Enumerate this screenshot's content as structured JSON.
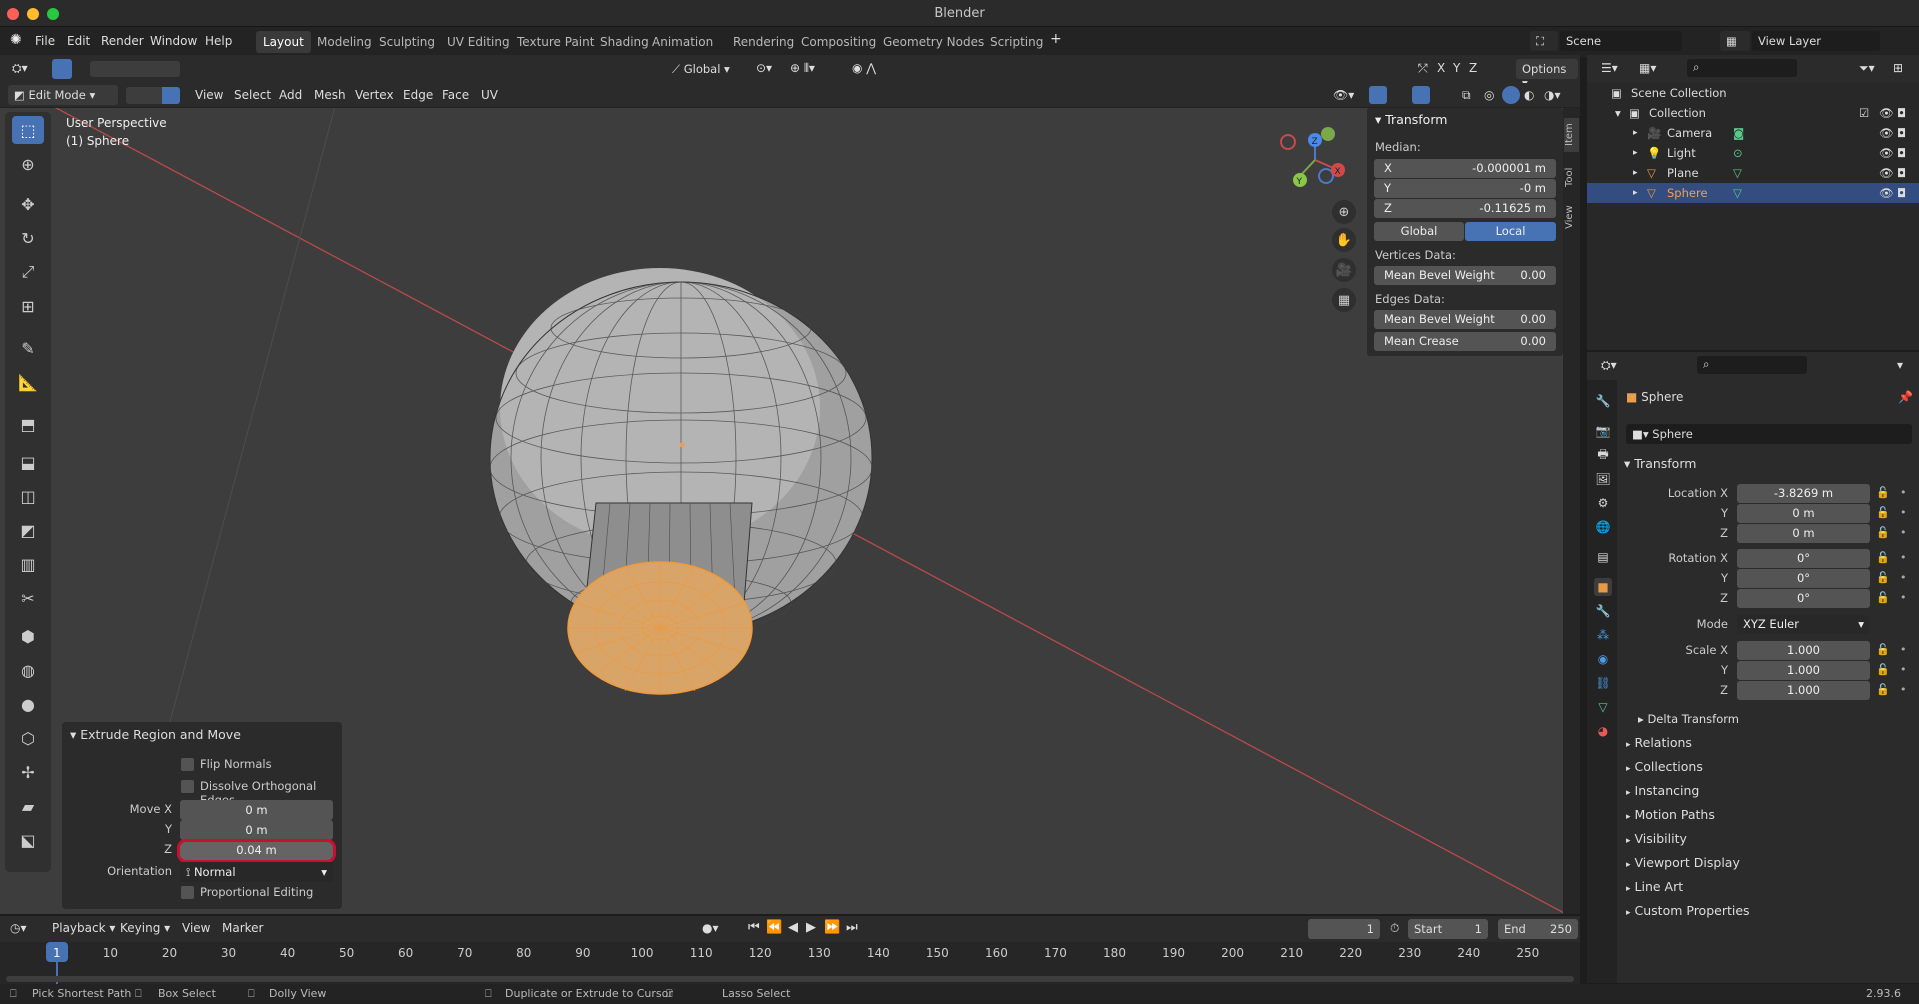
{
  "app": {
    "title": "Blender",
    "version": "2.93.6"
  },
  "menu": {
    "file": "File",
    "edit": "Edit",
    "render": "Render",
    "window": "Window",
    "help": "Help"
  },
  "workspaces": [
    "Layout",
    "Modeling",
    "Sculpting",
    "UV Editing",
    "Texture Paint",
    "Shading",
    "Animation",
    "Rendering",
    "Compositing",
    "Geometry Nodes",
    "Scripting"
  ],
  "scene": {
    "name": "Scene",
    "view_layer": "View Layer"
  },
  "tool_header": {
    "orientation": "Global",
    "options": "Options",
    "x": "X",
    "y": "Y",
    "z": "Z"
  },
  "viewport_header": {
    "mode": "Edit Mode",
    "view": "View",
    "select": "Select",
    "add": "Add",
    "mesh": "Mesh",
    "vertex": "Vertex",
    "edge": "Edge",
    "face": "Face",
    "uv": "UV"
  },
  "viewport": {
    "perspective": "User Perspective",
    "object": "(1) Sphere"
  },
  "gizmo": {
    "x": "X",
    "y": "Y",
    "z": "Z"
  },
  "npanel": {
    "section": "Transform",
    "median": "Median:",
    "x_label": "X",
    "x_value": "-0.000001 m",
    "y_label": "Y",
    "y_value": "-0 m",
    "z_label": "Z",
    "z_value": "-0.11625 m",
    "global": "Global",
    "local": "Local",
    "vertices_data": "Vertices Data:",
    "mean_bevel_weight": "Mean Bevel Weight",
    "vbw_value": "0.00",
    "edges_data": "Edges Data:",
    "ebw_value": "0.00",
    "mean_crease": "Mean Crease",
    "crease_value": "0.00"
  },
  "sidetabs": [
    "Item",
    "Tool",
    "View"
  ],
  "redo_panel": {
    "title": "Extrude Region and Move",
    "flip_normals": "Flip Normals",
    "dissolve": "Dissolve Orthogonal Edges",
    "move_x_label": "Move X",
    "move_x": "0 m",
    "y_label": "Y",
    "move_y": "0 m",
    "z_label": "Z",
    "move_z": "0.04 m",
    "orientation_label": "Orientation",
    "orientation": "Normal",
    "proportional": "Proportional Editing"
  },
  "outliner": {
    "root": "Scene Collection",
    "collection": "Collection",
    "items": [
      {
        "name": "Camera"
      },
      {
        "name": "Light"
      },
      {
        "name": "Plane"
      },
      {
        "name": "Sphere"
      }
    ]
  },
  "properties": {
    "object_name": "Sphere",
    "data_name": "Sphere",
    "transform": "Transform",
    "location_x_label": "Location X",
    "location_x": "-3.8269 m",
    "location_y": "0 m",
    "location_z": "0 m",
    "rotation_x_label": "Rotation X",
    "rotation_x": "0°",
    "rotation_y": "0°",
    "rotation_z": "0°",
    "mode_label": "Mode",
    "mode": "XYZ Euler",
    "scale_x_label": "Scale X",
    "scale_x": "1.000",
    "scale_y": "1.000",
    "scale_z": "1.000",
    "y_label": "Y",
    "z_label": "Z",
    "delta": "Delta Transform",
    "sections": [
      "Relations",
      "Collections",
      "Instancing",
      "Motion Paths",
      "Visibility",
      "Viewport Display",
      "Line Art",
      "Custom Properties"
    ]
  },
  "timeline": {
    "playback": "Playback",
    "keying": "Keying",
    "view": "View",
    "marker": "Marker",
    "current_frame": "1",
    "start_label": "Start",
    "start": "1",
    "end_label": "End",
    "end": "250",
    "ticks": [
      "1",
      "10",
      "20",
      "30",
      "40",
      "50",
      "60",
      "70",
      "80",
      "90",
      "100",
      "110",
      "120",
      "130",
      "140",
      "150",
      "160",
      "170",
      "180",
      "190",
      "200",
      "210",
      "220",
      "230",
      "240",
      "250"
    ]
  },
  "statusbar": {
    "pick": "Pick Shortest Path",
    "box": "Box Select",
    "dolly": "Dolly View",
    "duplicate": "Duplicate or Extrude to Cursor",
    "lasso": "Lasso Select"
  },
  "colors": {
    "accent": "#4772b3",
    "selection": "#e89a48",
    "highlight_ring": "#c8102e"
  }
}
